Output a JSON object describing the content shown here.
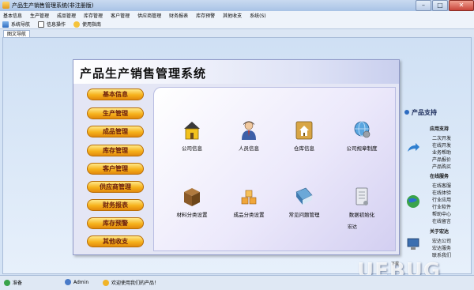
{
  "window": {
    "title": "产品生产销售管理系统(非注册版)"
  },
  "menu": [
    "基本信息",
    "生产管理",
    "成品管理",
    "库存管理",
    "客户管理",
    "供应商管理",
    "财务报表",
    "库存预警",
    "其他收支",
    "系统(S)"
  ],
  "toolbar": [
    {
      "label": "系统导航",
      "icon": "navigation-icon"
    },
    {
      "label": "信息操作",
      "icon": "info-icon"
    },
    {
      "label": "使用指南",
      "icon": "help-icon"
    }
  ],
  "tab": "图文导航",
  "panel_title": "产品生产销售管理系统",
  "nav_buttons": [
    "基本信息",
    "生产管理",
    "成品管理",
    "库存管理",
    "客户管理",
    "供应商管理",
    "财务报表",
    "库存预警",
    "其他收支"
  ],
  "icons": [
    {
      "label": "公司信息",
      "icon": "house-icon"
    },
    {
      "label": "人员信息",
      "icon": "person-icon"
    },
    {
      "label": "仓库信息",
      "icon": "warehouse-icon"
    },
    {
      "label": "公司规章制度",
      "icon": "gear-globe-icon"
    },
    {
      "label": "材料分类设置",
      "icon": "crate-icon"
    },
    {
      "label": "成品分类设置",
      "icon": "boxes-icon"
    },
    {
      "label": "常见问题管理",
      "icon": "book-icon"
    },
    {
      "label": "数据初始化",
      "icon": "database-icon"
    }
  ],
  "ad_text": "宏达",
  "sidebar": {
    "heading": "产品支持",
    "sections": [
      {
        "title": "应用支持",
        "links": [
          "二次开发",
          "在线开发",
          "业务帮助",
          "产品报价",
          "产品购买"
        ]
      },
      {
        "title": "在线服务",
        "links": [
          "在线客服",
          "在线体验",
          "行业应用",
          "行业软件",
          "帮助中心",
          "在线留言"
        ]
      },
      {
        "title": "关于宏达",
        "links": [
          "宏达公司",
          "宏达服务",
          "联系我们"
        ]
      }
    ]
  },
  "status": {
    "ready": "准备",
    "user": "Admin",
    "welcome": "欢迎使用我们的产品！"
  },
  "watermark": "UEBUG",
  "watermark_sub": "下载"
}
